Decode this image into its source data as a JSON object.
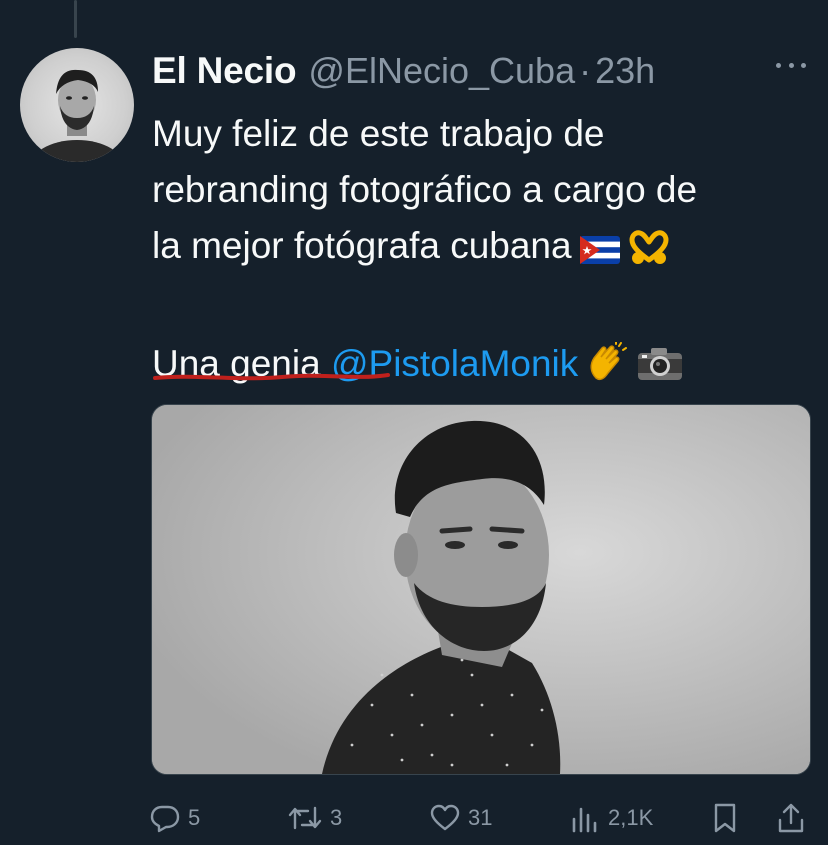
{
  "tweet": {
    "author_name": "El Necio",
    "author_handle": "@ElNecio_Cuba",
    "separator": "·",
    "time": "23h",
    "text_lines": [
      "Muy feliz de este trabajo de",
      "rebranding fotográfico a cargo de",
      "la mejor fotógrafa cubana"
    ],
    "emojis_line3": [
      "cuba-flag-emoji",
      "heart-hands-emoji"
    ],
    "text_second_paragraph": "Una genia",
    "mention": "@PistolaMonik",
    "emojis_line5": [
      "clapping-hands-emoji",
      "camera-emoji"
    ],
    "media_alt": "black and white portrait photo",
    "underline_color": "#c0201c"
  },
  "stats": {
    "replies": "5",
    "retweets": "3",
    "likes": "31",
    "views": "2,1K"
  },
  "colors": {
    "background": "#15202b",
    "text": "#f7f9f9",
    "secondary": "#8b98a5",
    "link": "#1d9bf0"
  }
}
